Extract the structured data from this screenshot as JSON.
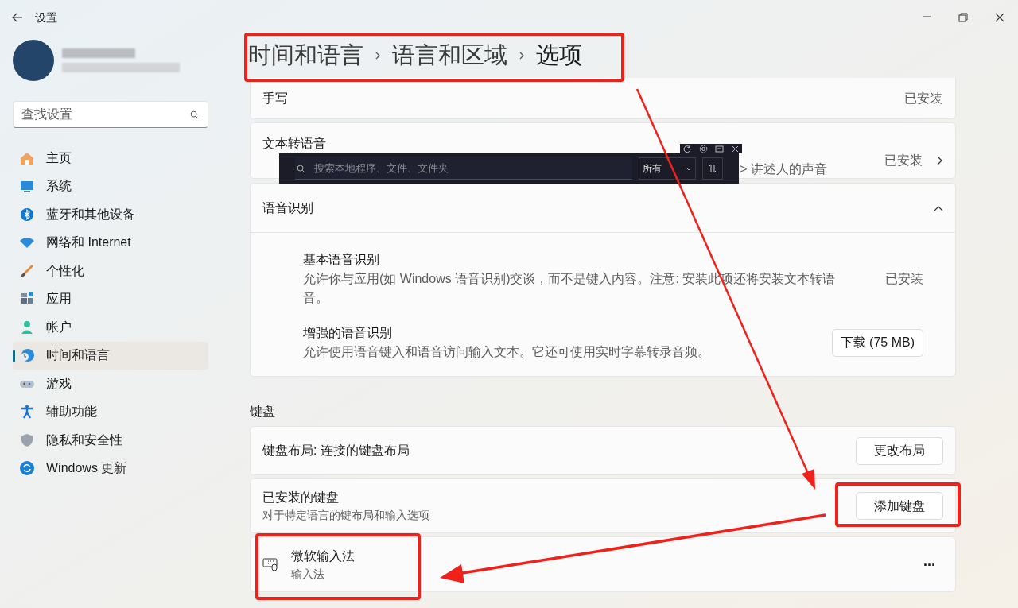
{
  "window": {
    "title": "设置"
  },
  "sidebar": {
    "search": {
      "placeholder": "查找设置"
    },
    "items": [
      {
        "label": "主页",
        "selected": false
      },
      {
        "label": "系统",
        "selected": false
      },
      {
        "label": "蓝牙和其他设备",
        "selected": false
      },
      {
        "label": "网络和 Internet",
        "selected": false
      },
      {
        "label": "个性化",
        "selected": false
      },
      {
        "label": "应用",
        "selected": false
      },
      {
        "label": "帐户",
        "selected": false
      },
      {
        "label": "时间和语言",
        "selected": true
      },
      {
        "label": "游戏",
        "selected": false
      },
      {
        "label": "辅助功能",
        "selected": false
      },
      {
        "label": "隐私和安全性",
        "selected": false
      },
      {
        "label": "Windows 更新",
        "selected": false
      }
    ]
  },
  "breadcrumb": [
    "时间和语言",
    "语言和区域",
    "选项"
  ],
  "handwriting": {
    "title": "手写",
    "status": "已安装"
  },
  "text_to_speech": {
    "title": "文本转语音",
    "subtitle_visible": "> 讲述人的声音",
    "status": "已安装"
  },
  "speech_recognition": {
    "title": "语音识别",
    "expanded": true,
    "items": [
      {
        "title": "基本语音识别",
        "description": "允许你与应用(如 Windows 语音识别)交谈，而不是键入内容。注意: 安装此项还将安装文本转语音。",
        "action": {
          "kind": "status",
          "label": "已安装"
        }
      },
      {
        "title": "增强的语音识别",
        "description": "允许使用语音键入和语音访问输入文本。它还可使用实时字幕转录音频。",
        "action": {
          "kind": "button",
          "label": "下载 (75 MB)"
        }
      }
    ]
  },
  "keyboard": {
    "heading": "键盘",
    "layout": {
      "label": "键盘布局: 连接的键盘布局",
      "button": "更改布局"
    },
    "installed": {
      "title": "已安装的键盘",
      "subtitle": "对于特定语言的键布局和输入选项",
      "button": "添加键盘"
    },
    "ime": {
      "title": "微软输入法",
      "subtitle": "输入法",
      "more": "..."
    }
  },
  "search_overlay": {
    "placeholder": "搜索本地程序、文件、文件夹",
    "filter": "所有"
  }
}
